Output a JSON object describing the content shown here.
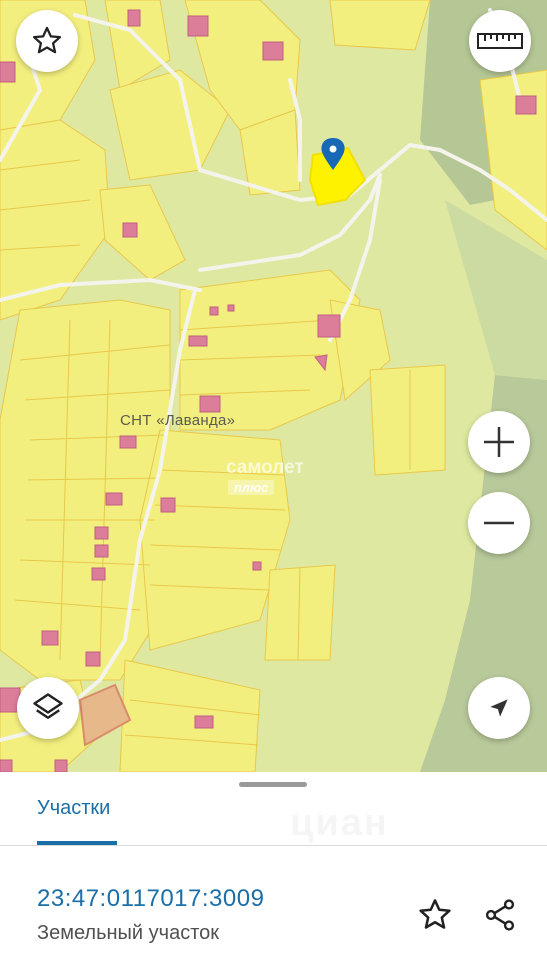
{
  "map": {
    "place_label": "СНТ «Лаванда»",
    "watermark": {
      "line1": "самолет",
      "line2": "плюс"
    },
    "colors": {
      "base": "#dfe8a0",
      "parcel_fill": "#f3ef7e",
      "parcel_stroke": "#e8c84a",
      "building": "#dc7d9a",
      "selected": "#fff200",
      "pin": "#1769b5",
      "forest": "#b5c795"
    },
    "controls": {
      "favorite_icon": "star-outline",
      "ruler_icon": "ruler",
      "zoom_in_icon": "plus",
      "zoom_out_icon": "minus",
      "layers_icon": "layers",
      "locate_icon": "navigation-arrow"
    }
  },
  "sheet": {
    "tab_label": "Участки",
    "parcel": {
      "cadastral_number": "23:47:0117017:3009",
      "type": "Земельный участок"
    },
    "actions": {
      "favorite_icon": "star-outline",
      "share_icon": "share"
    },
    "background_watermark": "циан"
  }
}
